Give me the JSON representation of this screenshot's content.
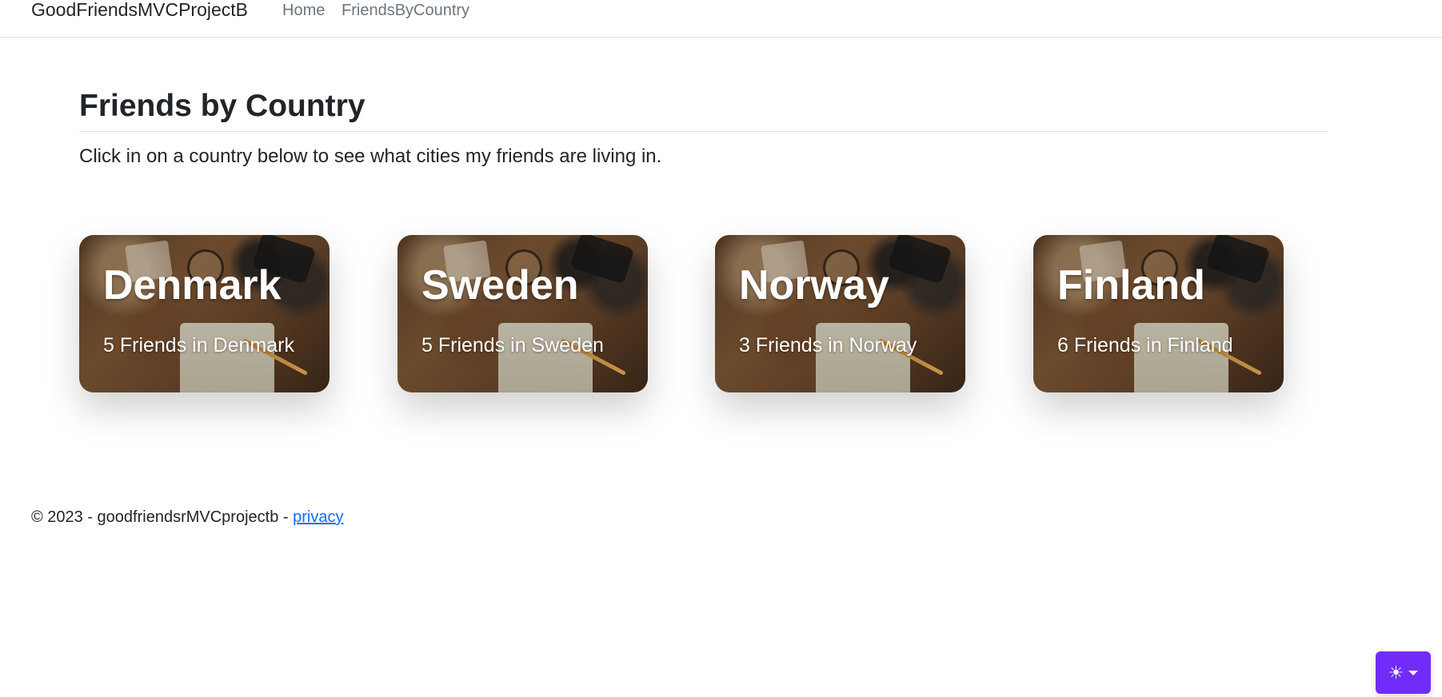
{
  "nav": {
    "brand": "GoodFriendsMVCProjectB",
    "links": [
      {
        "label": "Home"
      },
      {
        "label": "FriendsByCountry"
      }
    ]
  },
  "main": {
    "title": "Friends by Country",
    "lead": "Click in on a country below to see what cities my friends are living in.",
    "cards": [
      {
        "country": "Denmark",
        "count_text": "5 Friends in Denmark"
      },
      {
        "country": "Sweden",
        "count_text": "5 Friends in Sweden"
      },
      {
        "country": "Norway",
        "count_text": "3 Friends in Norway"
      },
      {
        "country": "Finland",
        "count_text": "6 Friends in Finland"
      }
    ]
  },
  "footer": {
    "text": "© 2023 - goodfriendsrMVCprojectb - ",
    "privacy_link": "privacy"
  },
  "theme_toggle": {
    "icon": "sun-icon",
    "glyph": "☀",
    "accent_color": "#712cf9"
  }
}
